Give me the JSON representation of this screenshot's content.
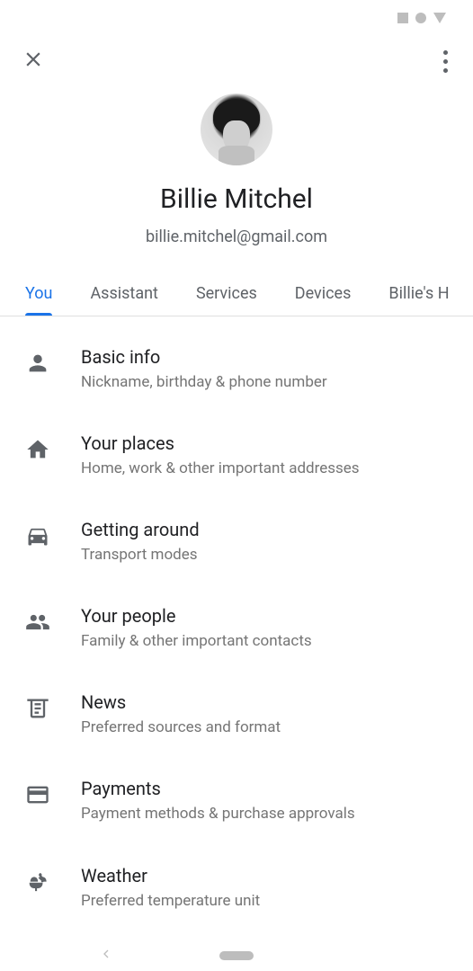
{
  "profile": {
    "name": "Billie Mitchel",
    "email": "billie.mitchel@gmail.com"
  },
  "tabs": [
    {
      "label": "You",
      "active": true
    },
    {
      "label": "Assistant",
      "active": false
    },
    {
      "label": "Services",
      "active": false
    },
    {
      "label": "Devices",
      "active": false
    },
    {
      "label": "Billie's H",
      "active": false
    }
  ],
  "settings": [
    {
      "title": "Basic info",
      "subtitle": "Nickname, birthday & phone number",
      "icon": "person-icon"
    },
    {
      "title": "Your places",
      "subtitle": "Home, work & other important addresses",
      "icon": "home-icon"
    },
    {
      "title": "Getting around",
      "subtitle": "Transport modes",
      "icon": "car-icon"
    },
    {
      "title": "Your people",
      "subtitle": "Family & other important contacts",
      "icon": "people-icon"
    },
    {
      "title": "News",
      "subtitle": "Preferred sources and format",
      "icon": "news-icon"
    },
    {
      "title": "Payments",
      "subtitle": "Payment methods & purchase approvals",
      "icon": "card-icon"
    },
    {
      "title": "Weather",
      "subtitle": "Preferred temperature unit",
      "icon": "umbrella-icon"
    }
  ]
}
